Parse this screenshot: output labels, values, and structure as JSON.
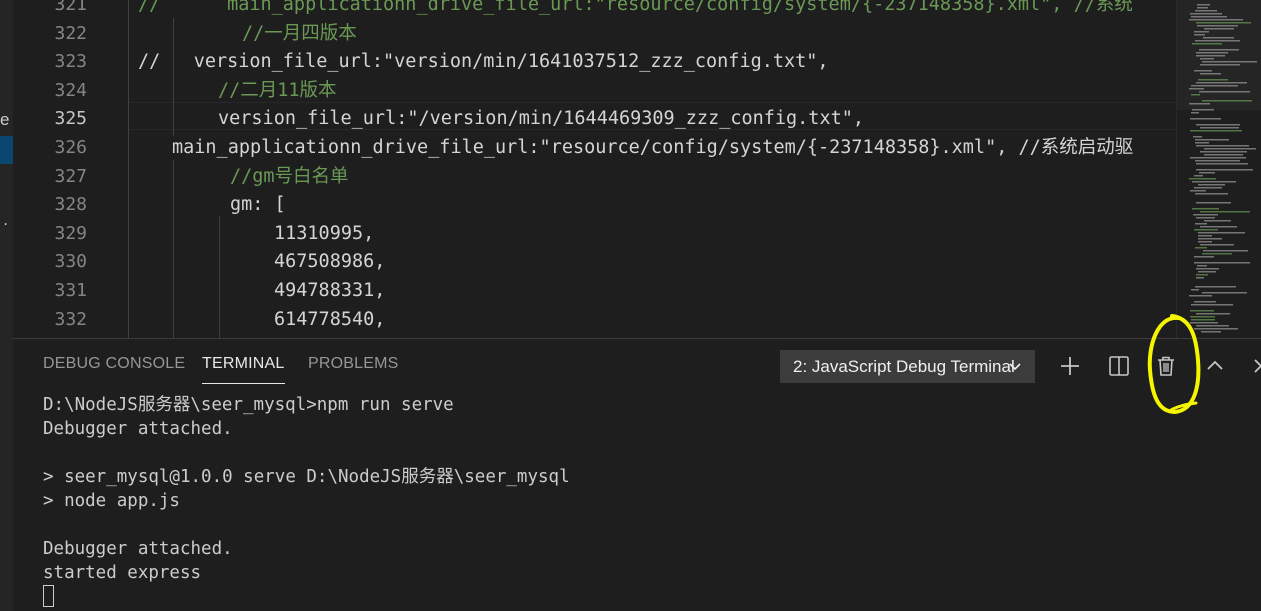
{
  "left_strip": {
    "fragment": "e"
  },
  "editor": {
    "lines": [
      {
        "num": "321",
        "text": "//      main_applicationn_drive_file_url:\"resource/config/system/{-237148358}.xml\", //系统",
        "comment": true,
        "indent": 0
      },
      {
        "num": "322",
        "text": "//一月四版本",
        "comment": true,
        "indent": 104
      },
      {
        "num": "323",
        "text": "//   version_file_url:\"version/min/1641037512_zzz_config.txt\",",
        "comment": false,
        "indent": 0
      },
      {
        "num": "324",
        "text": "//二月11版本",
        "comment": true,
        "indent": 80
      },
      {
        "num": "325",
        "text": "version_file_url:\"/version/min/1644469309_zzz_config.txt\",",
        "comment": false,
        "indent": 80,
        "active": true
      },
      {
        "num": "326",
        "text": "main_applicationn_drive_file_url:\"resource/config/system/{-237148358}.xml\", //系统启动驱",
        "comment": false,
        "indent": 34
      },
      {
        "num": "327",
        "text": "//gm号白名单",
        "comment": true,
        "indent": 92
      },
      {
        "num": "328",
        "text": "gm: [",
        "comment": false,
        "indent": 92
      },
      {
        "num": "329",
        "text": "11310995,",
        "comment": false,
        "indent": 136
      },
      {
        "num": "330",
        "text": "467508986,",
        "comment": false,
        "indent": 136
      },
      {
        "num": "331",
        "text": "494788331,",
        "comment": false,
        "indent": 136
      },
      {
        "num": "332",
        "text": "614778540,",
        "comment": false,
        "indent": 136
      }
    ]
  },
  "panel": {
    "tabs": [
      {
        "label": "DEBUG CONSOLE",
        "active": false
      },
      {
        "label": "TERMINAL",
        "active": true
      },
      {
        "label": "PROBLEMS",
        "active": false
      }
    ],
    "terminal_select": "2: JavaScript Debug Terminal",
    "icons": {
      "add": "plus-icon",
      "split": "split-editor-icon",
      "kill": "trash-icon",
      "maximize": "chevron-up-icon",
      "close": "close-icon"
    },
    "output": [
      "D:\\NodeJS服务器\\seer_mysql>npm run serve",
      "Debugger attached.",
      "",
      "> seer_mysql@1.0.0 serve D:\\NodeJS服务器\\seer_mysql",
      "> node app.js",
      "",
      "Debugger attached.",
      "started express"
    ]
  },
  "colors": {
    "background": "#1e1e1e",
    "comment": "#6a9955",
    "annotation": "#f5f500"
  }
}
